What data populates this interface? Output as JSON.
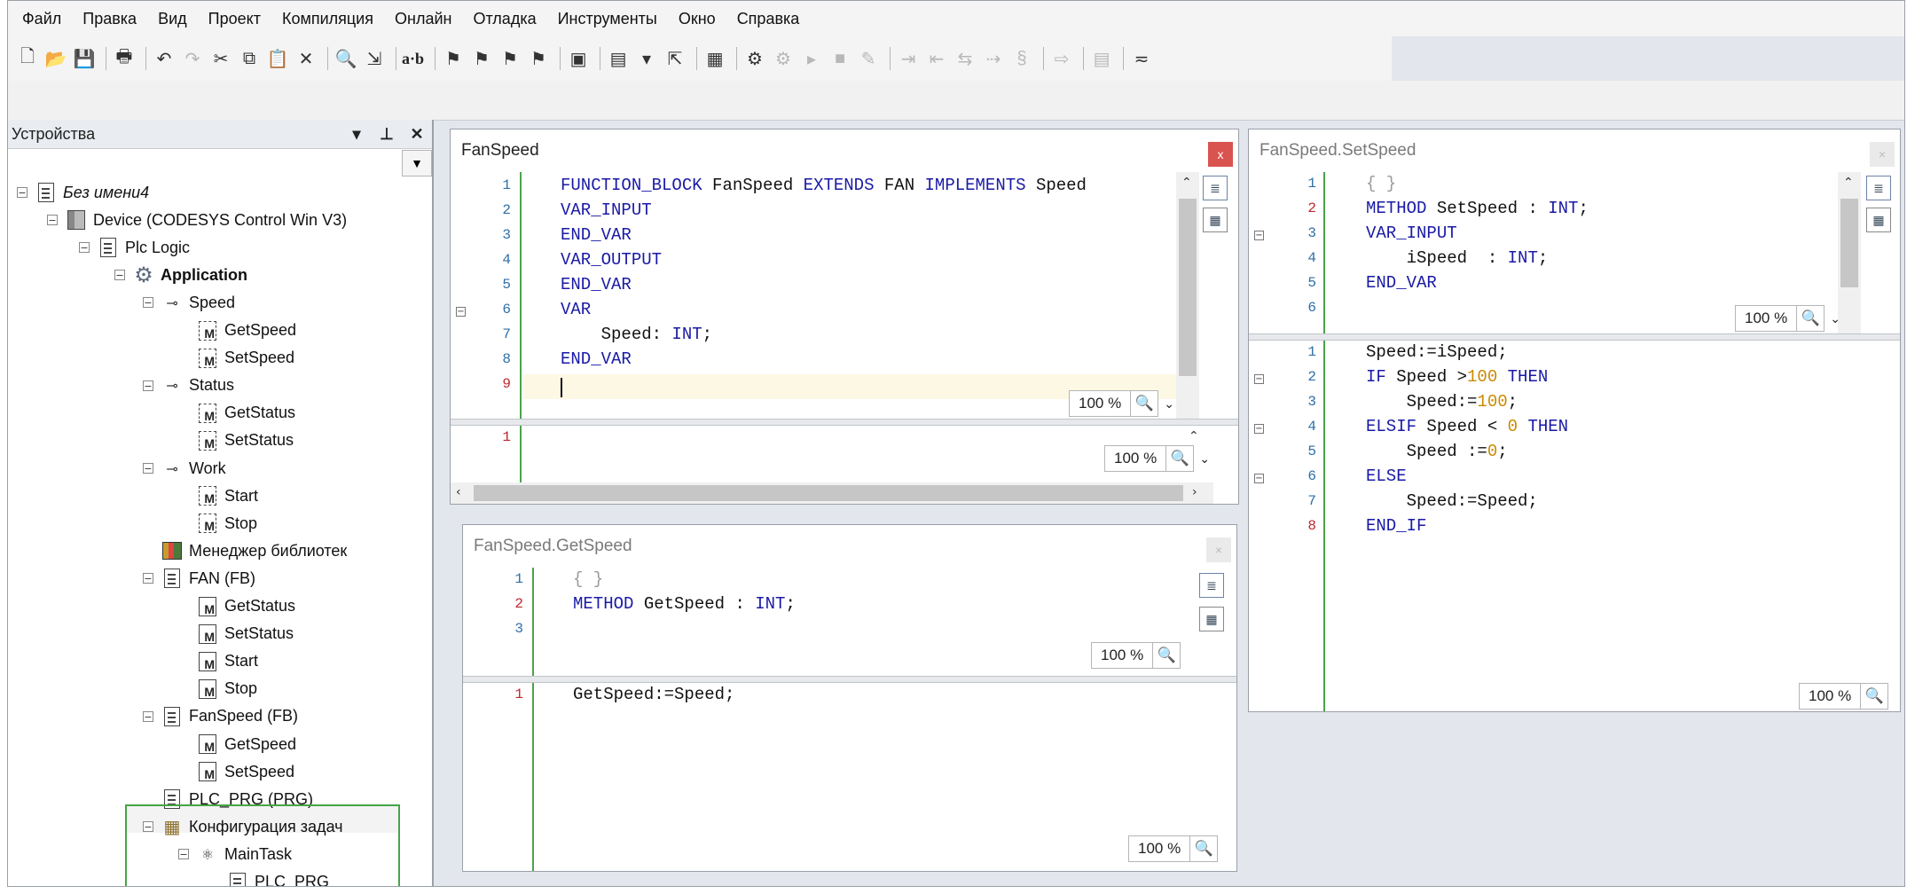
{
  "menu": [
    "Файл",
    "Правка",
    "Вид",
    "Проект",
    "Компиляция",
    "Онлайн",
    "Отладка",
    "Инструменты",
    "Окно",
    "Справка"
  ],
  "toolbar": {
    "find_replace_label": "a·b"
  },
  "devices_panel": {
    "title": "Устройства",
    "controls": [
      "▾",
      "⊥",
      "✕"
    ],
    "tree": [
      {
        "label": "Без имени4",
        "icon": "project-icon",
        "italic": true
      },
      {
        "label": "Device (CODESYS Control Win V3)",
        "icon": "device-icon"
      },
      {
        "label": "Plc Logic",
        "icon": "plc-logic-icon"
      },
      {
        "label": "Application",
        "icon": "application-gear-icon",
        "bold": true
      },
      {
        "label": "Speed",
        "icon": "interface-icon"
      },
      {
        "label": "GetSpeed",
        "icon": "interface-method-icon"
      },
      {
        "label": "SetSpeed",
        "icon": "interface-method-icon"
      },
      {
        "label": "Status",
        "icon": "interface-icon"
      },
      {
        "label": "GetStatus",
        "icon": "interface-method-icon"
      },
      {
        "label": "SetStatus",
        "icon": "interface-method-icon"
      },
      {
        "label": "Work",
        "icon": "interface-icon"
      },
      {
        "label": "Start",
        "icon": "interface-method-icon"
      },
      {
        "label": "Stop",
        "icon": "interface-method-icon"
      },
      {
        "label": "Менеджер библиотек",
        "icon": "library-manager-icon"
      },
      {
        "label": "FAN (FB)",
        "icon": "function-block-icon"
      },
      {
        "label": "GetStatus",
        "icon": "method-icon"
      },
      {
        "label": "SetStatus",
        "icon": "method-icon"
      },
      {
        "label": "Start",
        "icon": "method-icon"
      },
      {
        "label": "Stop",
        "icon": "method-icon"
      },
      {
        "label": "FanSpeed (FB)",
        "icon": "function-block-icon"
      },
      {
        "label": "GetSpeed",
        "icon": "method-icon"
      },
      {
        "label": "SetSpeed",
        "icon": "method-icon"
      },
      {
        "label": "PLC_PRG (PRG)",
        "icon": "program-icon"
      },
      {
        "label": "Конфигурация задач",
        "icon": "task-config-icon"
      },
      {
        "label": "MainTask",
        "icon": "task-icon"
      },
      {
        "label": "PLC_PRG",
        "icon": "program-call-icon"
      }
    ]
  },
  "editors": {
    "fanspeed": {
      "title": "FanSpeed",
      "close": "x",
      "decl_numbers": [
        "1",
        "2",
        "3",
        "4",
        "5",
        "6",
        "7",
        "8",
        "9"
      ],
      "impl_numbers": [
        "1"
      ],
      "zoom_decl": "100 %",
      "zoom_impl": "100 %"
    },
    "getspeed": {
      "title": "FanSpeed.GetSpeed",
      "decl_numbers": [
        "1",
        "2",
        "3"
      ],
      "impl_numbers": [
        "1"
      ],
      "zoom_decl": "100 %",
      "zoom_impl": "100 %"
    },
    "setspeed": {
      "title": "FanSpeed.SetSpeed",
      "decl_numbers": [
        "1",
        "2",
        "3",
        "4",
        "5",
        "6"
      ],
      "impl_numbers": [
        "1",
        "2",
        "3",
        "4",
        "5",
        "6",
        "7",
        "8"
      ],
      "zoom_decl": "100 %",
      "zoom_impl": "100 %"
    }
  }
}
